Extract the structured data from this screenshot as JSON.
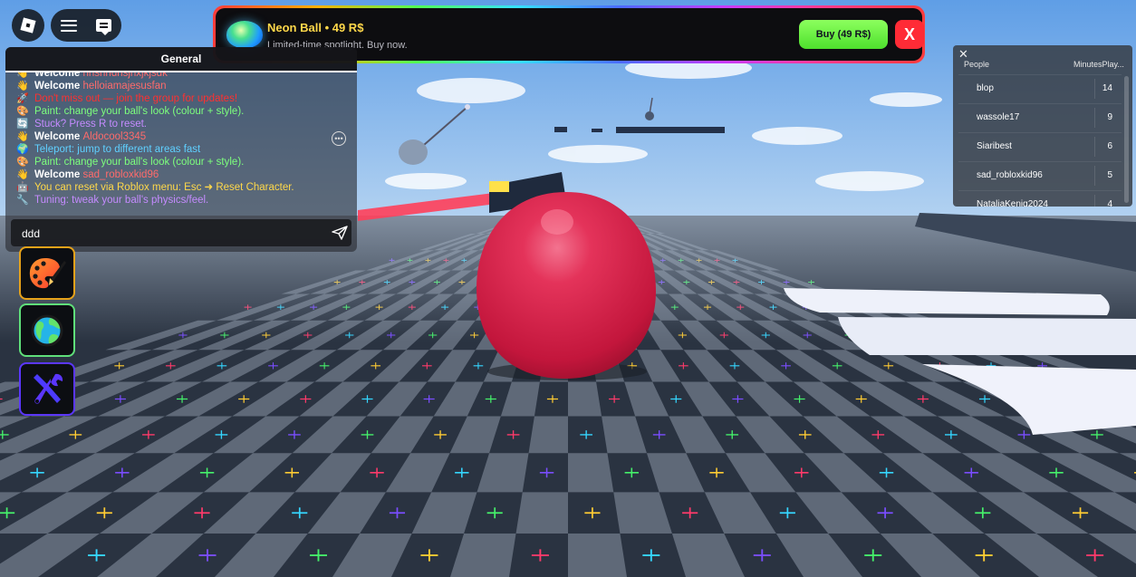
{
  "promo": {
    "title": "Neon Ball • 49 R$",
    "subtitle": "Limited-time spotlight. Buy now.",
    "buy_label": "Buy (49 R$)",
    "close_label": "X"
  },
  "chat": {
    "channel": "General",
    "messages": [
      {
        "icon": "wave-icon",
        "prefix": "Welcome",
        "text": "hhshhdhsjhxjkjsdk",
        "color": "#ff6b6b"
      },
      {
        "icon": "wave-icon",
        "prefix": "Welcome",
        "text": "helloiamajesusfan",
        "color": "#ff6b6b"
      },
      {
        "icon": "rocket-icon",
        "prefix": "",
        "text": "Don't miss out — join the group for updates!",
        "color": "#ff3030"
      },
      {
        "icon": "palette-icon",
        "prefix": "",
        "text": "Paint: change your ball's look (colour + style).",
        "color": "#7dff7d"
      },
      {
        "icon": "reset-icon",
        "prefix": "",
        "text": "Stuck? Press R to reset.",
        "color": "#c58bff"
      },
      {
        "icon": "wave-icon",
        "prefix": "Welcome",
        "text": "Aldocool3345",
        "color": "#ff6b6b"
      },
      {
        "icon": "globe-icon",
        "prefix": "",
        "text": "Teleport: jump to different areas fast",
        "color": "#5fd0ff"
      },
      {
        "icon": "palette-icon",
        "prefix": "",
        "text": "Paint: change your ball's look (colour + style).",
        "color": "#7dff7d"
      },
      {
        "icon": "wave-icon",
        "prefix": "Welcome",
        "text": "sad_robloxkid96",
        "color": "#ff6b6b"
      },
      {
        "icon": "robot-icon",
        "prefix": "",
        "text": "You can reset via Roblox menu: Esc ➜ Reset Character.",
        "color": "#ffd84a"
      },
      {
        "icon": "wrench-icon",
        "prefix": "",
        "text": "Tuning: tweak your ball's physics/feel.",
        "color": "#c58bff"
      }
    ],
    "input_value": "ddd"
  },
  "leaderboard": {
    "header_people": "People",
    "header_minutes": "MinutesPlay...",
    "rows": [
      {
        "name": "blop",
        "value": "14"
      },
      {
        "name": "wassole17",
        "value": "9"
      },
      {
        "name": "Siaribest",
        "value": "6"
      },
      {
        "name": "sad_robloxkid96",
        "value": "5"
      },
      {
        "name": "NataliaKenig2024",
        "value": "4"
      }
    ]
  },
  "side_buttons": [
    {
      "name": "paint",
      "icon": "palette-icon"
    },
    {
      "name": "teleport",
      "icon": "globe-icon"
    },
    {
      "name": "tuning",
      "icon": "wrench-icon"
    }
  ],
  "colors": {
    "player_ball": "#d81e45",
    "buy_button": "#5ee83a",
    "close_button": "#ff2b36",
    "promo_title": "#ffd84a"
  }
}
